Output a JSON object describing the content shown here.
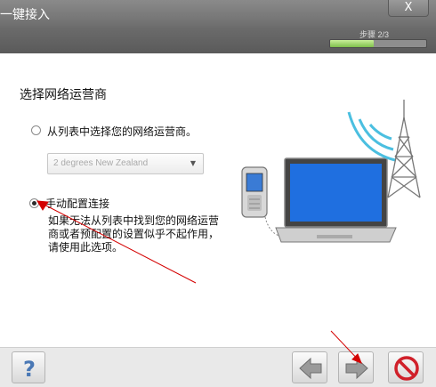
{
  "window": {
    "title": "一键接入",
    "close_label": "X"
  },
  "header": {
    "step_text": "步骤 2/3",
    "progress": 0.45
  },
  "page": {
    "title": "选择网络运营商"
  },
  "options": [
    {
      "label": "从列表中选择您的网络运营商。",
      "checked": false
    },
    {
      "label": "手动配置连接",
      "checked": true
    }
  ],
  "operator_select": {
    "value": "2 degrees New Zealand"
  },
  "manual_description": [
    "如果无法从列表中找到您的网络运营",
    "商或者预配置的设置似乎不起作用，",
    "请使用此选项。"
  ],
  "footer": {
    "help_icon": "question-mark-icon",
    "back_icon": "arrow-left-icon",
    "next_icon": "arrow-right-icon",
    "cancel_icon": "stop-icon"
  },
  "colors": {
    "accent_green": "#7fc04b",
    "cancel_red": "#d0202a",
    "annotation_red": "#d40000"
  }
}
